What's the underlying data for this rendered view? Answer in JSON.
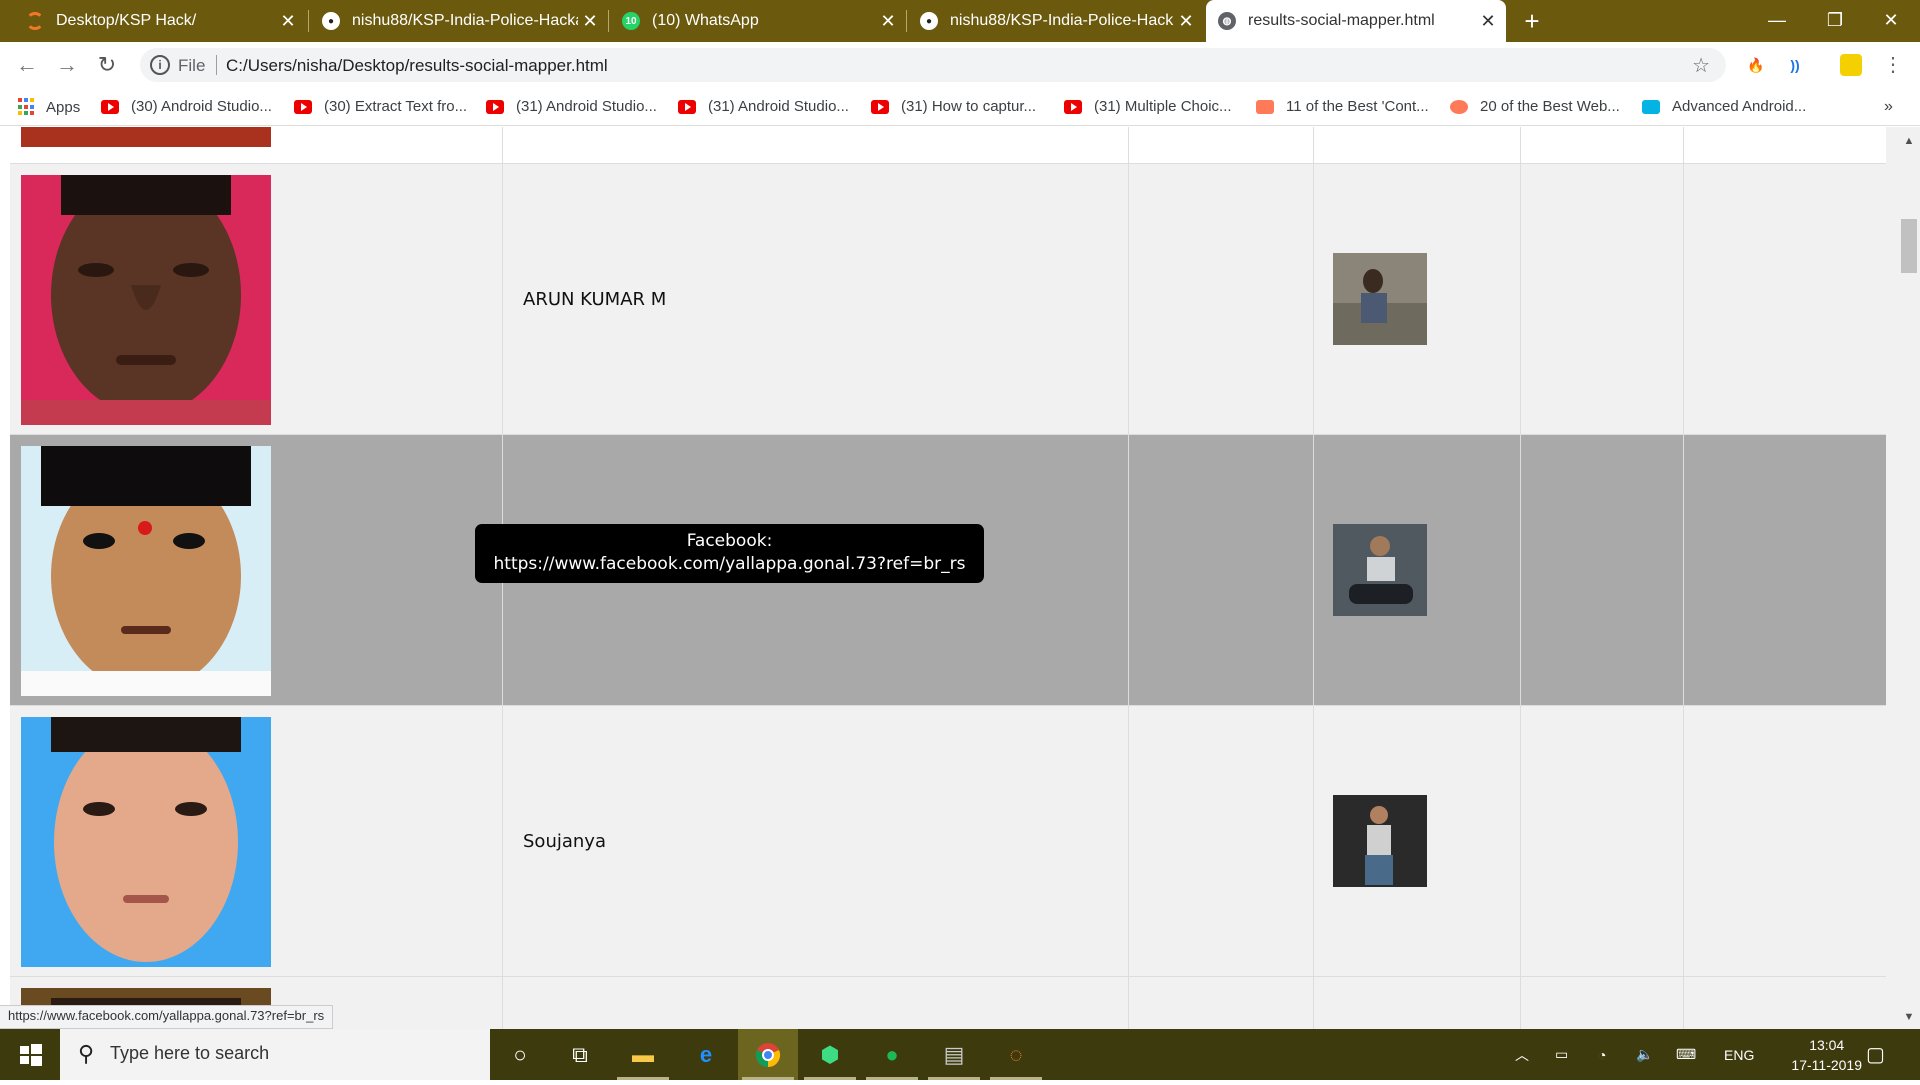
{
  "browser": {
    "tabs": [
      {
        "title": "Desktop/KSP Hack/",
        "icon": "jupyter-icon",
        "active": false
      },
      {
        "title": "nishu88/KSP-India-Police-Hackat",
        "icon": "github-icon",
        "active": false
      },
      {
        "title": "(10) WhatsApp",
        "icon": "whatsapp-icon",
        "active": false
      },
      {
        "title": "nishu88/KSP-India-Police-Hackat",
        "icon": "github-icon",
        "active": false
      },
      {
        "title": "results-social-mapper.html",
        "icon": "globe-icon",
        "active": true
      }
    ],
    "new_tab": "+",
    "address": {
      "scheme": "File",
      "url": "C:/Users/nisha/Desktop/results-social-mapper.html"
    },
    "bookmarks": [
      {
        "label": "Apps",
        "icon": "apps-grid-icon"
      },
      {
        "label": "(30) Android Studio...",
        "icon": "youtube-icon"
      },
      {
        "label": "(30) Extract Text fro...",
        "icon": "youtube-icon"
      },
      {
        "label": "(31) Android Studio...",
        "icon": "youtube-icon"
      },
      {
        "label": "(31) Android Studio...",
        "icon": "youtube-icon"
      },
      {
        "label": "(31) How to captur...",
        "icon": "youtube-icon"
      },
      {
        "label": "(31) Multiple Choic...",
        "icon": "youtube-icon"
      },
      {
        "label": "11 of the Best 'Cont...",
        "icon": "hubspot-icon"
      },
      {
        "label": "20 of the Best Web...",
        "icon": "hubspot-icon"
      },
      {
        "label": "Advanced Android...",
        "icon": "udacity-icon"
      }
    ],
    "bookmarks_overflow": "»"
  },
  "results": {
    "rows": [
      {
        "name": "ARUN KUMAR M"
      },
      {
        "name": ""
      },
      {
        "name": "Soujanya"
      }
    ],
    "tooltip": {
      "line1": "Facebook:",
      "line2": "https://www.facebook.com/yallappa.gonal.73?ref=br_rs"
    }
  },
  "status_url": "https://www.facebook.com/yallappa.gonal.73?ref=br_rs",
  "taskbar": {
    "search_placeholder": "Type here to search",
    "language": "ENG",
    "time": "13:04",
    "date": "17-11-2019"
  },
  "colors": {
    "tab_strip": "#6b5a0e",
    "taskbar": "#3d3a0e",
    "row_bg": "#f1f1f1",
    "row_hover": "#a9a9a9"
  }
}
